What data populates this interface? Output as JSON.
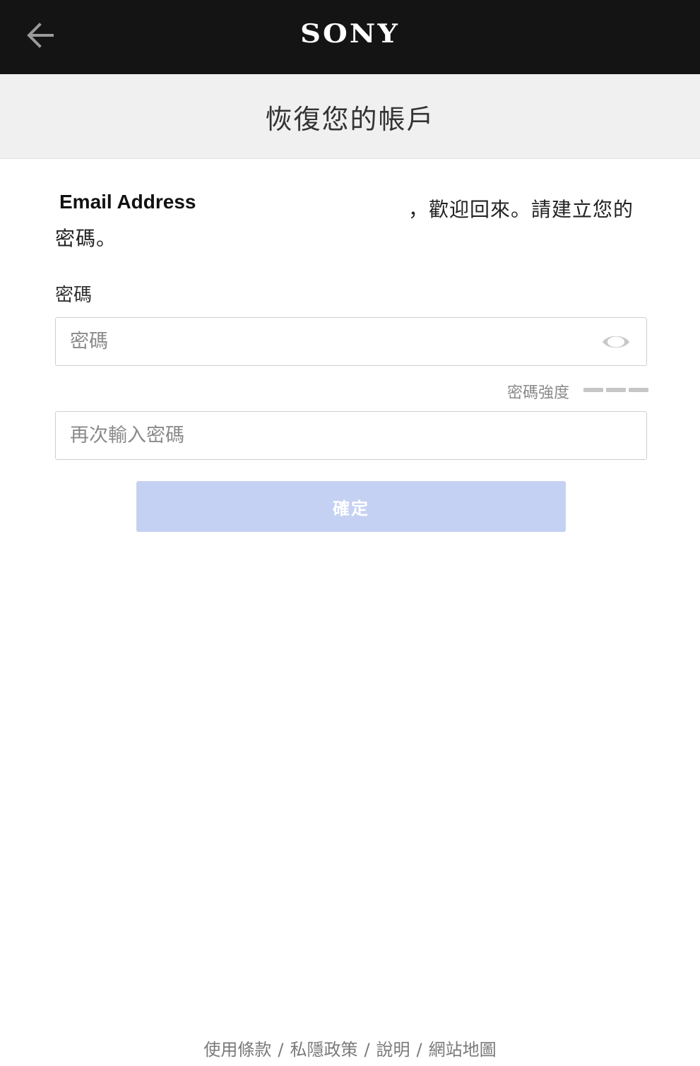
{
  "header": {
    "brand": "SONY",
    "back_icon": "arrow-left-icon"
  },
  "title_band": {
    "title": "恢復您的帳戶"
  },
  "greeting": {
    "email": "Email Address",
    "welcome": "，歡迎回來。請建立您的",
    "create_password": "密碼。"
  },
  "form": {
    "password_label": "密碼",
    "password_placeholder": "密碼",
    "password_value": "",
    "show_password_icon": "eye-icon",
    "strength_label": "密碼強度",
    "confirm_placeholder": "再次輸入密碼",
    "confirm_value": "",
    "submit_label": "確定"
  },
  "footer": {
    "links": [
      "使用條款",
      "私隱政策",
      "說明",
      "網站地圖"
    ],
    "separator": "/"
  },
  "colors": {
    "topbar": "#141414",
    "title_band": "#f0f0f0",
    "submit_disabled": "#c5d1f2",
    "strength_bar": "#c6c6c6"
  }
}
